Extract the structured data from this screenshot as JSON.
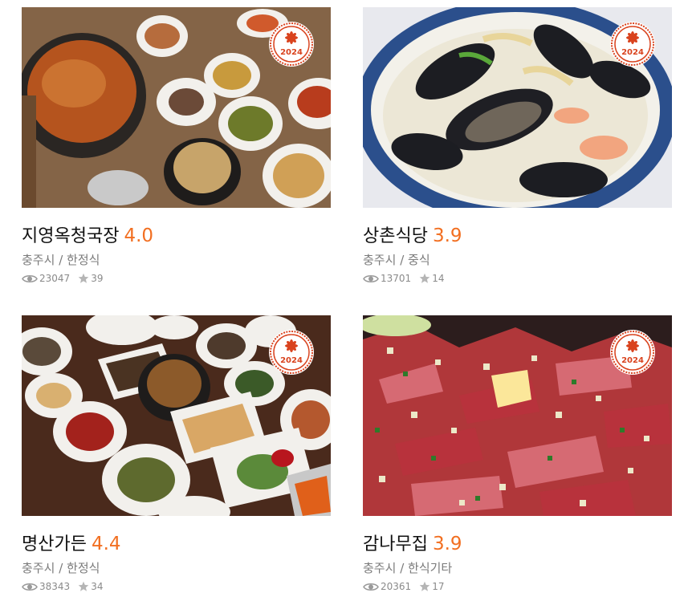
{
  "colors": {
    "rating": "#f26f21",
    "badge_red": "#d9431e",
    "meta": "#7b7b7b"
  },
  "icons": {
    "views": "eye-icon",
    "favorites": "star-icon",
    "award": "award-badge-icon"
  },
  "restaurants": [
    {
      "name": "지영옥청국장",
      "rating": "4.0",
      "region": "충주시",
      "sep": "/",
      "category": "한정식",
      "views": "23047",
      "stars": "39",
      "badge_year": "2024"
    },
    {
      "name": "상촌식당",
      "rating": "3.9",
      "region": "충주시",
      "sep": "/",
      "category": "중식",
      "views": "13701",
      "stars": "14",
      "badge_year": "2024"
    },
    {
      "name": "명산가든",
      "rating": "4.4",
      "region": "충주시",
      "sep": "/",
      "category": "한정식",
      "views": "38343",
      "stars": "34",
      "badge_year": "2024"
    },
    {
      "name": "감나무집",
      "rating": "3.9",
      "region": "충주시",
      "sep": "/",
      "category": "한식기타",
      "views": "20361",
      "stars": "17",
      "badge_year": "2024"
    }
  ]
}
